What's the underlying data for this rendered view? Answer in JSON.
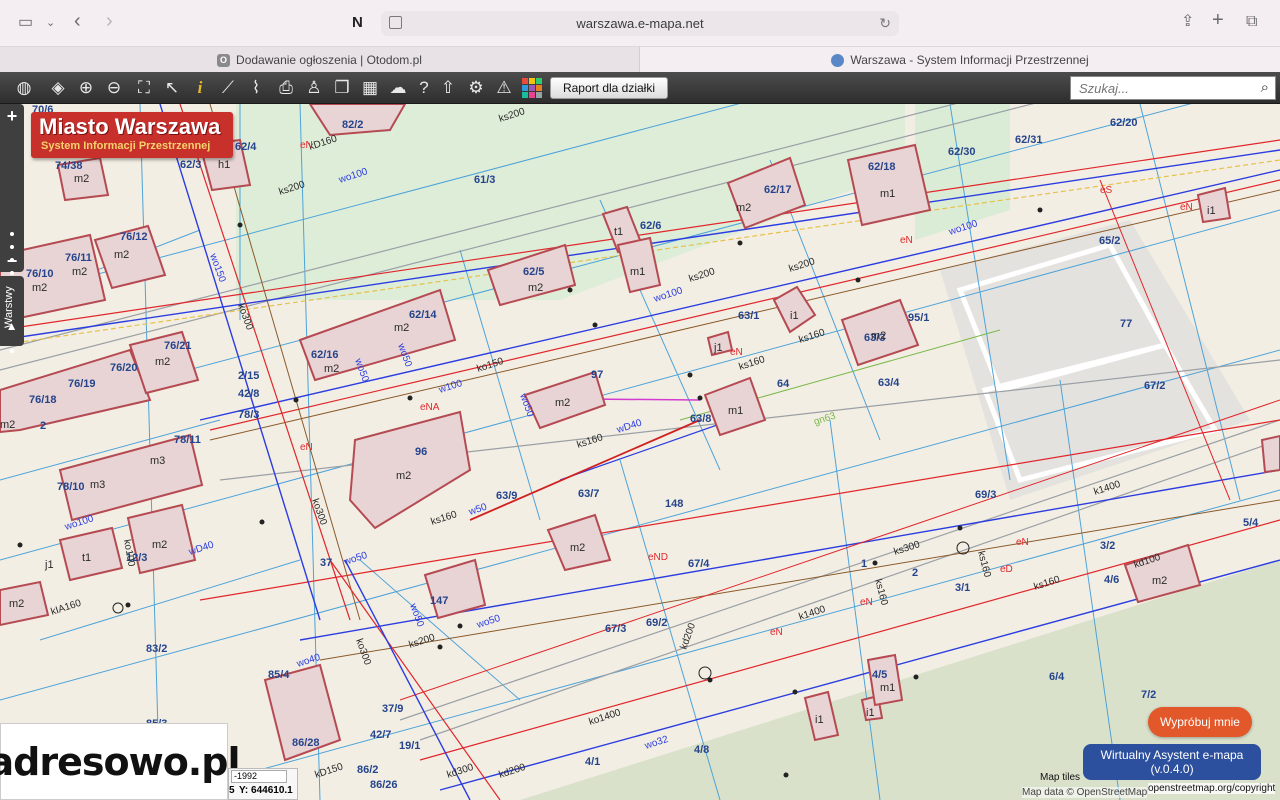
{
  "browser": {
    "url": "warszawa.e-mapa.net",
    "tabs": [
      {
        "label": "Dodawanie ogłoszenia | Otodom.pl",
        "favicon": "O"
      },
      {
        "label": "Warszawa - System Informacji Przestrzennej",
        "favicon": "globe-icon"
      }
    ]
  },
  "toolbar": {
    "report_button": "Raport dla działki",
    "search_placeholder": "Szukaj...",
    "icons": [
      "world-map-icon",
      "layers-icon",
      "zoom-in-icon",
      "zoom-out-icon",
      "zoom-extent-icon",
      "pointer-icon",
      "info-icon",
      "measure-line-icon",
      "measure-area-icon",
      "print-icon",
      "street-view-icon",
      "copy-icon",
      "layout-icon",
      "comment-icon",
      "help-icon",
      "cloud-upload-icon",
      "settings-icon",
      "warning-icon",
      "color-grid-icon"
    ]
  },
  "map": {
    "logo_title": "Miasto Warszawa",
    "logo_subtitle": "System Informacji Przestrzennej",
    "layers_tab": "Warstwy",
    "parcel_labels": [
      "70/6",
      "82/2",
      "61/3",
      "62/20",
      "62/31",
      "62/30",
      "62/18",
      "62/17",
      "62/6",
      "74/38",
      "76/12",
      "76/11",
      "76/10",
      "62/5",
      "62/14",
      "62/16",
      "63/1",
      "95/1",
      "63/3",
      "63/4",
      "64",
      "63/8",
      "76/21",
      "76/20",
      "76/19",
      "76/18",
      "97",
      "96",
      "78/11",
      "78/10",
      "63/9",
      "63/7",
      "148",
      "69/3",
      "67/4",
      "147",
      "67/3",
      "69/2",
      "83/2",
      "85/4",
      "86/28",
      "85/3",
      "37/9",
      "42/7",
      "19/1",
      "4/5",
      "4/8",
      "6/4",
      "7/2",
      "5/4",
      "3/2",
      "3/1",
      "4/6",
      "2",
      "1",
      "77",
      "67/2",
      "65/2",
      "h1",
      "t1",
      "i1",
      "j1",
      "s"
    ],
    "building_labels": [
      "m2",
      "m1",
      "i1",
      "t1",
      "j1",
      "m3"
    ],
    "utility_labels": [
      "ks200",
      "wo100",
      "w",
      "kD160",
      "ks160",
      "wo50",
      "eN",
      "k1400",
      "ko300",
      "ks300",
      "kd300",
      "wD40",
      "gn63",
      "ks150",
      "wo150",
      "ks500"
    ]
  },
  "footer": {
    "brand": "adresowo.pl",
    "crs": "-1992",
    "coord_x": "5",
    "coord_y": "Y: 644610.1",
    "map_tiles": "Map tiles",
    "map_data": "Map data © OpenStreetMap",
    "osm_copyright": "openstreetmap.org/copyright"
  },
  "assistant": {
    "try_button": "Wypróbuj mnie",
    "assistant_title": "Wirtualny Asystent e-mapa",
    "assistant_version": "(v.0.4.0)"
  }
}
